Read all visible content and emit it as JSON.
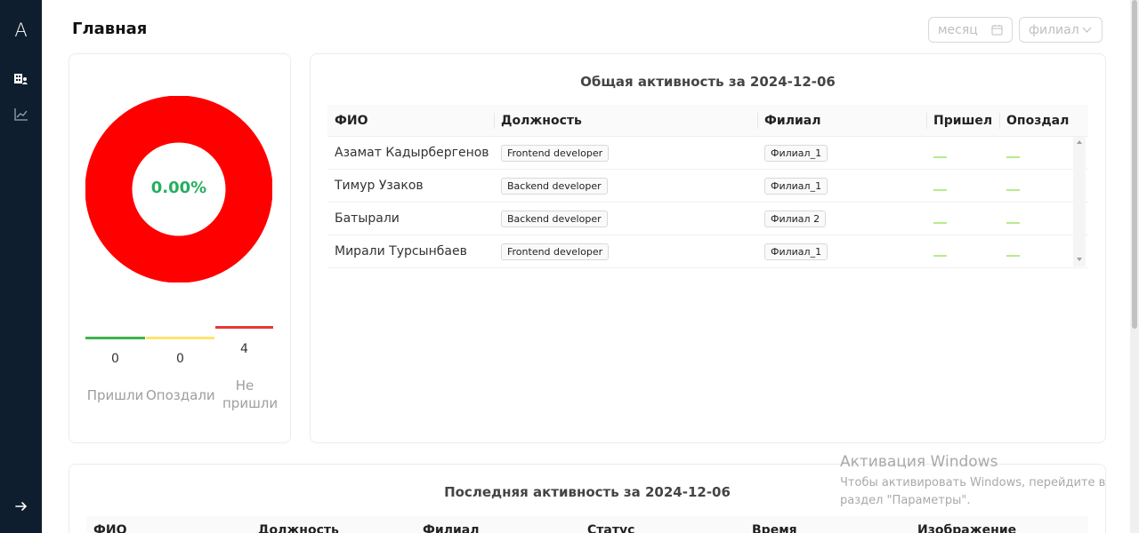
{
  "app": {
    "logo_letter": "A"
  },
  "page": {
    "title": "Главная"
  },
  "filters": {
    "month_placeholder": "месяц",
    "branch_placeholder": "филиал"
  },
  "summary": {
    "percent": "0.00%",
    "counts": [
      {
        "value": "0",
        "label": "Пришли",
        "color": "#3cb44b"
      },
      {
        "value": "0",
        "label": "Опоздали",
        "color": "#ffe36e"
      },
      {
        "value": "4",
        "label": "Не пришли",
        "color": "#e53935"
      }
    ],
    "donut_color": "#ff0000"
  },
  "activity": {
    "title": "Общая активность за 2024-12-06",
    "columns": [
      "ФИО",
      "Должность",
      "Филиал",
      "Пришел",
      "Опоздал"
    ],
    "rows": [
      {
        "name": "Азамат Кадырбергенов",
        "position": "Frontend developer",
        "branch": "Филиал_1"
      },
      {
        "name": "Тимур Узаков",
        "position": "Backend developer",
        "branch": "Филиал_1"
      },
      {
        "name": "Батырали",
        "position": "Backend developer",
        "branch": "Филиал 2"
      },
      {
        "name": "Мирали Турсынбаев",
        "position": "Frontend developer",
        "branch": "Филиал_1"
      }
    ]
  },
  "recent": {
    "title": "Последняя активность за 2024-12-06",
    "columns": [
      "ФИО",
      "Должность",
      "Филиал",
      "Статус",
      "Время",
      "Изображение"
    ]
  },
  "watermark": {
    "line1": "Активация Windows",
    "line2": "Чтобы активировать Windows, перейдите в",
    "line3": "раздел \"Параметры\"."
  }
}
